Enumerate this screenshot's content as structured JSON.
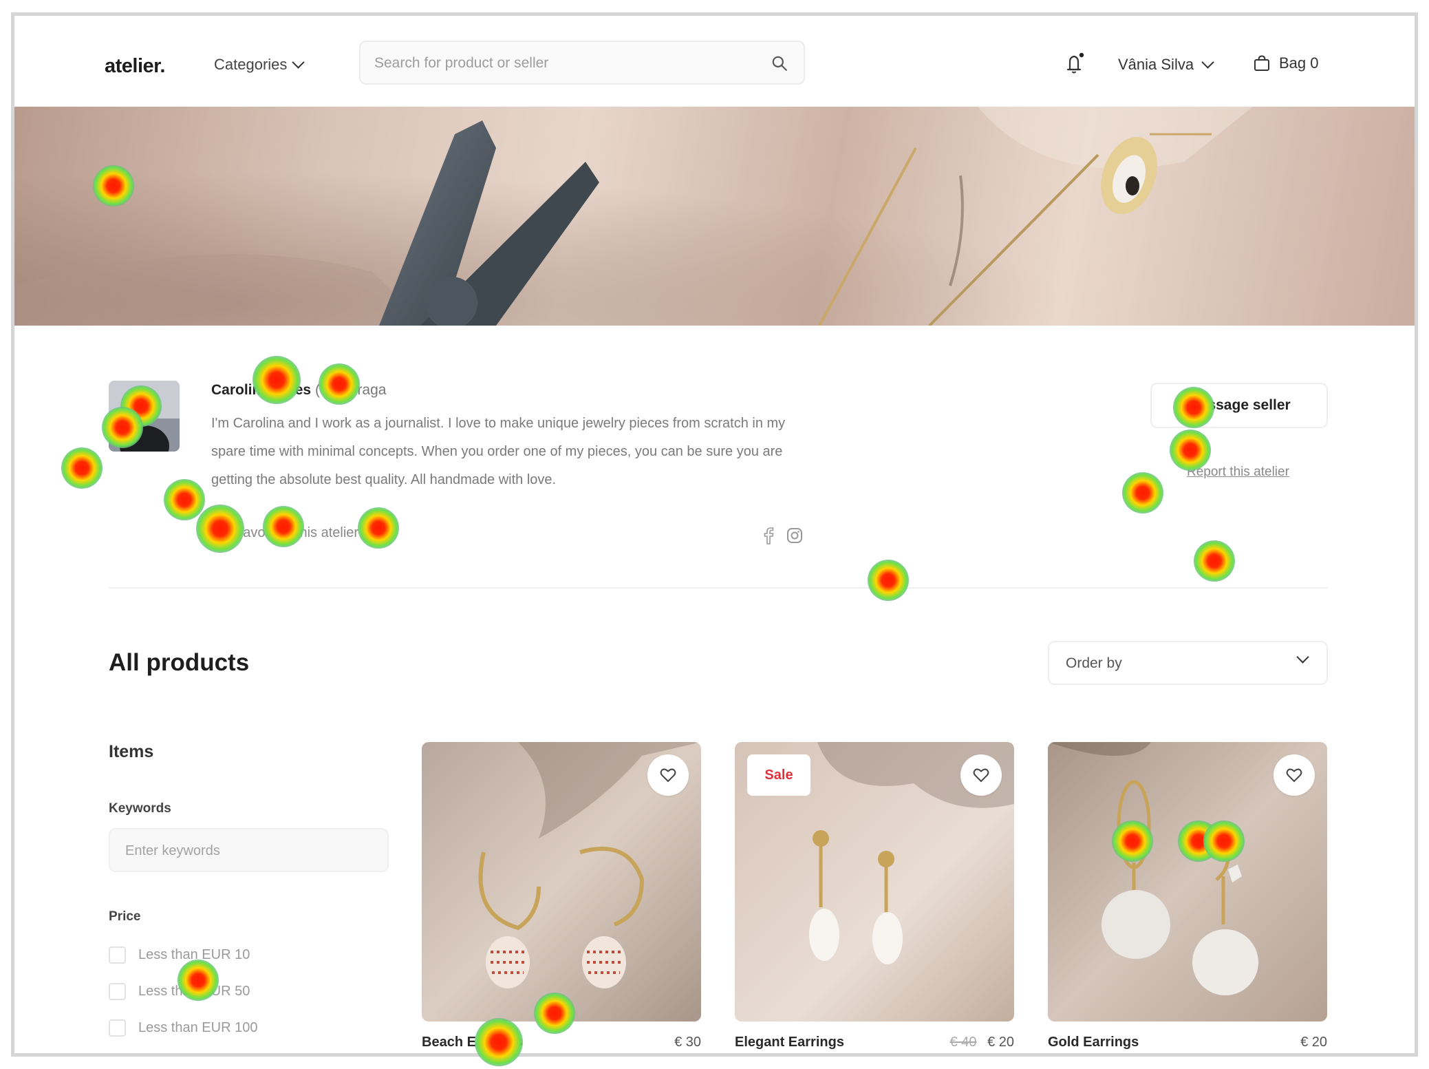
{
  "header": {
    "logo": "atelier.",
    "categories_label": "Categories",
    "search_placeholder": "Search for product or seller",
    "user_name": "Vânia Silva",
    "bag_label": "Bag 0"
  },
  "seller": {
    "name": "Carolina Alves",
    "location": "(Vila Braga",
    "bio": "I'm Carolina and I work as a journalist. I love to make unique jewelry pieces from scratch in my spare time with minimal concepts. When you order one of my pieces, you can be sure you are getting the absolute best quality. All handmade with love.",
    "favourite_label": "Favourite this atelier (103)",
    "message_button": "Message seller",
    "report_link": "Report this atelier"
  },
  "products_section": {
    "title": "All products",
    "order_by": "Order by"
  },
  "filters": {
    "title": "Items",
    "keywords_label": "Keywords",
    "keywords_placeholder": "Enter keywords",
    "price_label": "Price",
    "price_options": [
      "Less than EUR 10",
      "Less than EUR 50",
      "Less than EUR 100"
    ]
  },
  "products": [
    {
      "name": "Beach Earrings",
      "price": "€ 30",
      "old_price": "",
      "badge": ""
    },
    {
      "name": "Elegant Earrings",
      "price": "€ 20",
      "old_price": "€ 40",
      "badge": "Sale"
    },
    {
      "name": "Gold Earrings",
      "price": "€ 20",
      "old_price": "",
      "badge": ""
    }
  ],
  "colors": {
    "sale_red": "#e0303a",
    "heat_hot": "#ff1a00",
    "heat_warm": "#ffd500",
    "heat_cool": "#6fe04a",
    "heat_edge": "#5a6eff"
  }
}
